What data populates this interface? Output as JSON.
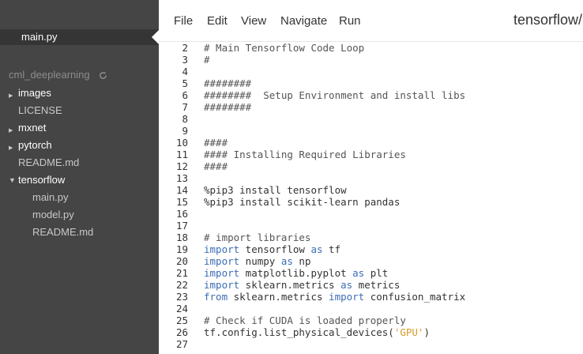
{
  "sidebar": {
    "open_file": "main.py",
    "project": "cml_deeplearning",
    "tree": [
      {
        "label": "images",
        "type": "dir",
        "collapsed": true
      },
      {
        "label": "LICENSE",
        "type": "file"
      },
      {
        "label": "mxnet",
        "type": "dir",
        "collapsed": true
      },
      {
        "label": "pytorch",
        "type": "dir",
        "collapsed": true
      },
      {
        "label": "README.md",
        "type": "file"
      },
      {
        "label": "tensorflow",
        "type": "dir",
        "collapsed": false
      },
      {
        "label": "main.py",
        "type": "file"
      },
      {
        "label": "model.py",
        "type": "file"
      },
      {
        "label": "README.md",
        "type": "file"
      }
    ]
  },
  "menu": {
    "file": "File",
    "edit": "Edit",
    "view": "View",
    "navigate": "Navigate",
    "run": "Run",
    "breadcrumb": "tensorflow/"
  },
  "editor": {
    "lines": [
      {
        "n": "2",
        "tokens": [
          {
            "t": "# Main Tensorflow Code Loop",
            "k": "comment"
          }
        ]
      },
      {
        "n": "3",
        "tokens": [
          {
            "t": "#",
            "k": "comment"
          }
        ]
      },
      {
        "n": "4",
        "tokens": []
      },
      {
        "n": "5",
        "tokens": [
          {
            "t": "########",
            "k": "comment"
          }
        ]
      },
      {
        "n": "6",
        "tokens": [
          {
            "t": "########  Setup Environment and install libs",
            "k": "comment"
          }
        ]
      },
      {
        "n": "7",
        "tokens": [
          {
            "t": "########",
            "k": "comment"
          }
        ]
      },
      {
        "n": "8",
        "tokens": []
      },
      {
        "n": "9",
        "tokens": []
      },
      {
        "n": "10",
        "tokens": [
          {
            "t": "####",
            "k": "comment"
          }
        ]
      },
      {
        "n": "11",
        "tokens": [
          {
            "t": "#### Installing Required Libraries",
            "k": "comment"
          }
        ]
      },
      {
        "n": "12",
        "tokens": [
          {
            "t": "####",
            "k": "comment"
          }
        ]
      },
      {
        "n": "13",
        "tokens": []
      },
      {
        "n": "14",
        "tokens": [
          {
            "t": "%pip3 install tensorflow",
            "k": "plain"
          }
        ]
      },
      {
        "n": "15",
        "tokens": [
          {
            "t": "%pip3 install scikit-learn pandas",
            "k": "plain"
          }
        ]
      },
      {
        "n": "16",
        "tokens": []
      },
      {
        "n": "17",
        "tokens": []
      },
      {
        "n": "18",
        "tokens": [
          {
            "t": "# import libraries",
            "k": "comment"
          }
        ]
      },
      {
        "n": "19",
        "tokens": [
          {
            "t": "import",
            "k": "kw"
          },
          {
            "t": " tensorflow ",
            "k": "plain"
          },
          {
            "t": "as",
            "k": "kw"
          },
          {
            "t": " tf",
            "k": "plain"
          }
        ]
      },
      {
        "n": "20",
        "tokens": [
          {
            "t": "import",
            "k": "kw"
          },
          {
            "t": " numpy ",
            "k": "plain"
          },
          {
            "t": "as",
            "k": "kw"
          },
          {
            "t": " np",
            "k": "plain"
          }
        ]
      },
      {
        "n": "21",
        "tokens": [
          {
            "t": "import",
            "k": "kw"
          },
          {
            "t": " matplotlib.pyplot ",
            "k": "plain"
          },
          {
            "t": "as",
            "k": "kw"
          },
          {
            "t": " plt",
            "k": "plain"
          }
        ]
      },
      {
        "n": "22",
        "tokens": [
          {
            "t": "import",
            "k": "kw"
          },
          {
            "t": " sklearn.metrics ",
            "k": "plain"
          },
          {
            "t": "as",
            "k": "kw"
          },
          {
            "t": " metrics",
            "k": "plain"
          }
        ]
      },
      {
        "n": "23",
        "tokens": [
          {
            "t": "from",
            "k": "kw"
          },
          {
            "t": " sklearn.metrics ",
            "k": "plain"
          },
          {
            "t": "import",
            "k": "kw"
          },
          {
            "t": " confusion_matrix",
            "k": "plain"
          }
        ]
      },
      {
        "n": "24",
        "tokens": []
      },
      {
        "n": "25",
        "tokens": [
          {
            "t": "# Check if CUDA is loaded properly",
            "k": "comment"
          }
        ]
      },
      {
        "n": "26",
        "tokens": [
          {
            "t": "tf.config.list_physical_devices(",
            "k": "plain"
          },
          {
            "t": "'GPU'",
            "k": "str"
          },
          {
            "t": ")",
            "k": "plain"
          }
        ]
      },
      {
        "n": "27",
        "tokens": []
      }
    ]
  },
  "colors": {
    "sidebar_bg": "#454545",
    "keyword": "#3b6db5",
    "string": "#d69c28"
  }
}
